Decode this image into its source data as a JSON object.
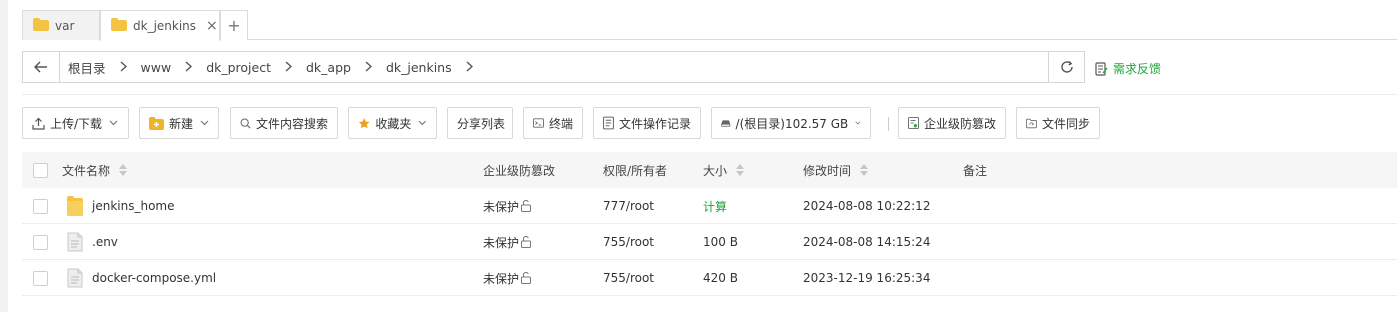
{
  "tabs": [
    {
      "label": "var",
      "icon": "folder-icon",
      "active": false
    },
    {
      "label": "dk_jenkins",
      "icon": "folder-icon",
      "active": true,
      "close": "×"
    }
  ],
  "add_tab": "+",
  "breadcrumb": [
    "根目录",
    "www",
    "dk_project",
    "dk_app",
    "dk_jenkins"
  ],
  "feedback_label": "需求反馈",
  "toolbar": {
    "upload": "上传/下载",
    "new": "新建",
    "search": "文件内容搜索",
    "favorites": "收藏夹",
    "share_list": "分享列表",
    "terminal": "终端",
    "op_log": "文件操作记录",
    "disk": "/(根目录)102.57 GB",
    "tamper": "企业级防篡改",
    "sync": "文件同步"
  },
  "table": {
    "headers": {
      "name": "文件名称",
      "tamper": "企业级防篡改",
      "perm": "权限/所有者",
      "size": "大小",
      "mtime": "修改时间",
      "note": "备注"
    },
    "rows": [
      {
        "name": "jenkins_home",
        "type": "folder",
        "tamper": "未保护",
        "perm": "777/root",
        "size": "计算",
        "mtime": "2024-08-08 10:22:12",
        "note": ""
      },
      {
        "name": ".env",
        "type": "file",
        "tamper": "未保护",
        "perm": "755/root",
        "size": "100 B",
        "mtime": "2024-08-08 14:15:24",
        "note": ""
      },
      {
        "name": "docker-compose.yml",
        "type": "file",
        "tamper": "未保护",
        "perm": "755/root",
        "size": "420 B",
        "mtime": "2023-12-19 16:25:34",
        "note": ""
      }
    ]
  },
  "colors": {
    "accent": "#20a53a",
    "folder": "#f5c342"
  }
}
